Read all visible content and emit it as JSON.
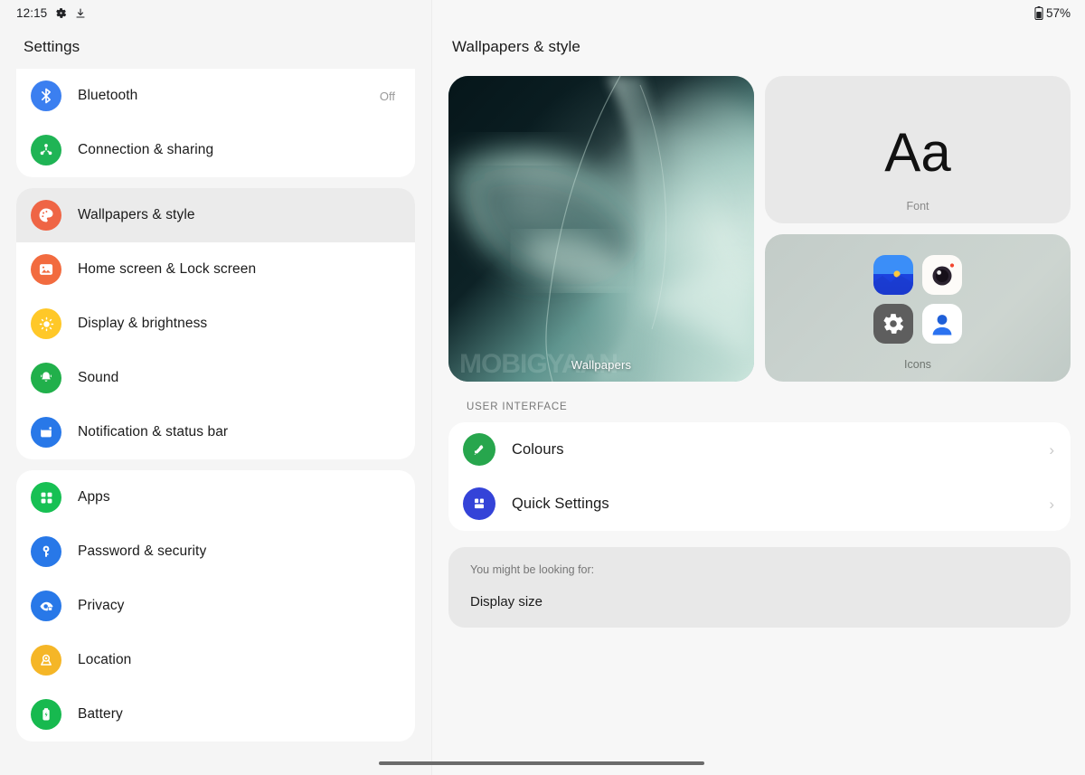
{
  "status_bar": {
    "time": "12:15",
    "left_icons": [
      "gear-icon",
      "download-icon"
    ],
    "battery_percent": "57%",
    "battery_icon": "battery-icon"
  },
  "sidebar": {
    "title": "Settings",
    "groups": [
      {
        "items": [
          {
            "label": "Bluetooth",
            "value": "Off",
            "icon": "bluetooth-icon",
            "color": "#3b7ff0",
            "selected": false
          },
          {
            "label": "Connection & sharing",
            "value": "",
            "icon": "connection-sharing-icon",
            "color": "#1fb455",
            "selected": false
          }
        ]
      },
      {
        "items": [
          {
            "label": "Wallpapers & style",
            "value": "",
            "icon": "palette-icon",
            "color": "#ef6545",
            "selected": true
          },
          {
            "label": "Home screen & Lock screen",
            "value": "",
            "icon": "image-icon",
            "color": "#f26b3f",
            "selected": false
          },
          {
            "label": "Display & brightness",
            "value": "",
            "icon": "brightness-icon",
            "color": "#ffc828",
            "selected": false
          },
          {
            "label": "Sound",
            "value": "",
            "icon": "bell-icon",
            "color": "#21b04b",
            "selected": false
          },
          {
            "label": "Notification & status bar",
            "value": "",
            "icon": "notification-icon",
            "color": "#2878e8",
            "selected": false
          }
        ]
      },
      {
        "items": [
          {
            "label": "Apps",
            "value": "",
            "icon": "apps-grid-icon",
            "color": "#17c053",
            "selected": false
          },
          {
            "label": "Password & security",
            "value": "",
            "icon": "key-icon",
            "color": "#2878e8",
            "selected": false
          },
          {
            "label": "Privacy",
            "value": "",
            "icon": "privacy-eye-icon",
            "color": "#2878e8",
            "selected": false
          },
          {
            "label": "Location",
            "value": "",
            "icon": "location-pin-icon",
            "color": "#f5b627",
            "selected": false
          },
          {
            "label": "Battery",
            "value": "",
            "icon": "battery-charge-icon",
            "color": "#17b94f",
            "selected": false
          }
        ]
      }
    ]
  },
  "main": {
    "title": "Wallpapers & style",
    "wallpaper_card": {
      "label": "Wallpapers",
      "watermark": "MOBIGYAAN"
    },
    "font_card": {
      "sample": "Aa",
      "label": "Font"
    },
    "icons_card": {
      "label": "Icons",
      "app_icons": [
        "gallery-icon",
        "camera-icon",
        "settings-gear-icon",
        "contacts-icon"
      ]
    },
    "section_header": "USER INTERFACE",
    "ui_rows": [
      {
        "label": "Colours",
        "icon": "paint-roller-icon",
        "color": "#27a64d",
        "chevron": "›"
      },
      {
        "label": "Quick Settings",
        "icon": "quick-settings-icon",
        "color": "#3443d8",
        "chevron": "›"
      }
    ],
    "suggestion_card": {
      "title": "You might be looking for:",
      "items": [
        "Display size"
      ]
    }
  },
  "nav_bar": {
    "handle": "gesture-handle"
  }
}
